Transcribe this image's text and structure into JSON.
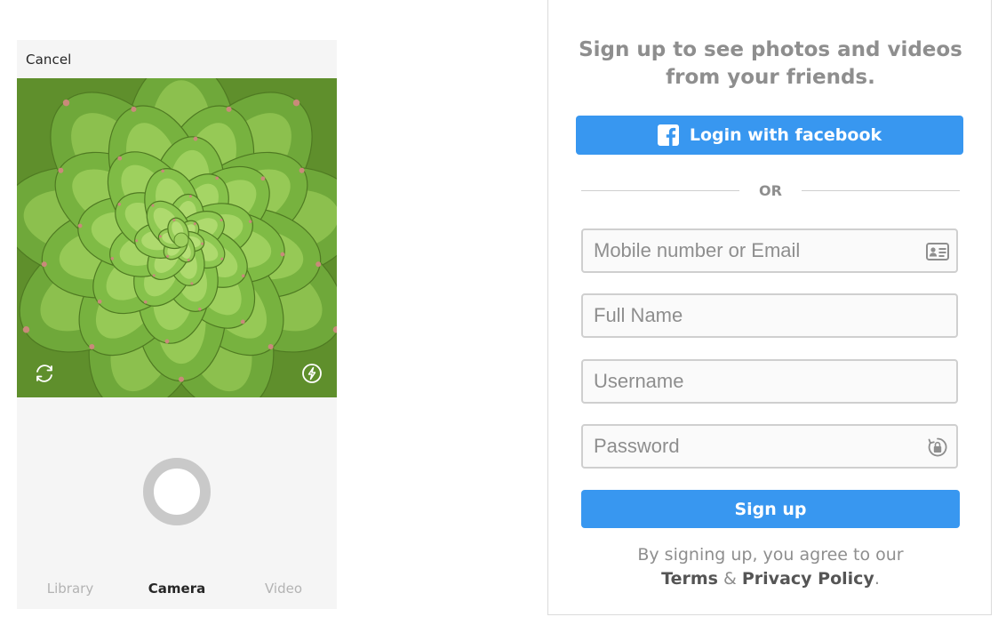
{
  "camera_screen": {
    "cancel_label": "Cancel",
    "icons": {
      "rotate": "camera-switch-icon",
      "flash": "flash-icon"
    },
    "tabs": [
      {
        "label": "Library",
        "active": false
      },
      {
        "label": "Camera",
        "active": true
      },
      {
        "label": "Video",
        "active": false
      }
    ]
  },
  "signup": {
    "tagline_line1": "Sign up to see photos and videos",
    "tagline_line2": "from your friends.",
    "facebook_button_label": "Login with facebook",
    "divider_text": "OR",
    "fields": {
      "contact": {
        "placeholder": "Mobile number or Email",
        "value": "",
        "icon": "contact-card-icon"
      },
      "fullname": {
        "placeholder": "Full Name",
        "value": ""
      },
      "username": {
        "placeholder": "Username",
        "value": ""
      },
      "password": {
        "placeholder": "Password",
        "value": "",
        "icon": "password-lock-icon"
      }
    },
    "signup_button_label": "Sign up",
    "terms_prefix": "By signing up, you agree to our",
    "terms_link": "Terms",
    "terms_and": "&",
    "privacy_link": "Privacy Policy",
    "terms_period": "."
  },
  "colors": {
    "accent": "#3897f0",
    "muted_text": "#8e8e8e",
    "border": "#dbdbdb",
    "leaf_green": "#7cb342"
  }
}
